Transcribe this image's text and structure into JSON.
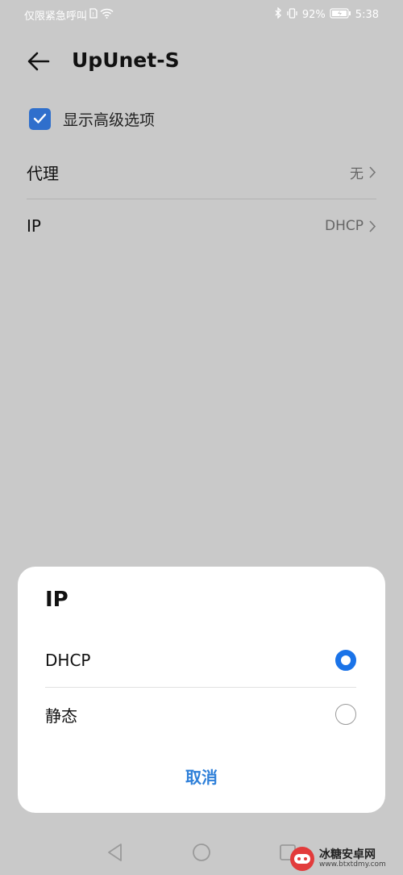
{
  "status_bar": {
    "carrier": "仅限紧急呼叫",
    "battery": "92%",
    "time": "5:38"
  },
  "header": {
    "back_icon": "arrow-left-icon",
    "title": "UpUnet-S"
  },
  "advanced": {
    "checkbox_label": "显示高级选项",
    "checked": true
  },
  "settings": {
    "proxy": {
      "label": "代理",
      "value": "无"
    },
    "ip": {
      "label": "IP",
      "value": "DHCP"
    }
  },
  "dialog": {
    "title": "IP",
    "options": [
      {
        "label": "DHCP",
        "selected": true
      },
      {
        "label": "静态",
        "selected": false
      }
    ],
    "cancel_label": "取消"
  },
  "watermark": {
    "title": "冰糖安卓网",
    "url": "www.btxtdmy.com"
  },
  "colors": {
    "accent": "#2f6fcc",
    "radio_selected": "#1a73e8",
    "cancel_text": "#2f80d9",
    "scrim": "#c9c9c9"
  }
}
